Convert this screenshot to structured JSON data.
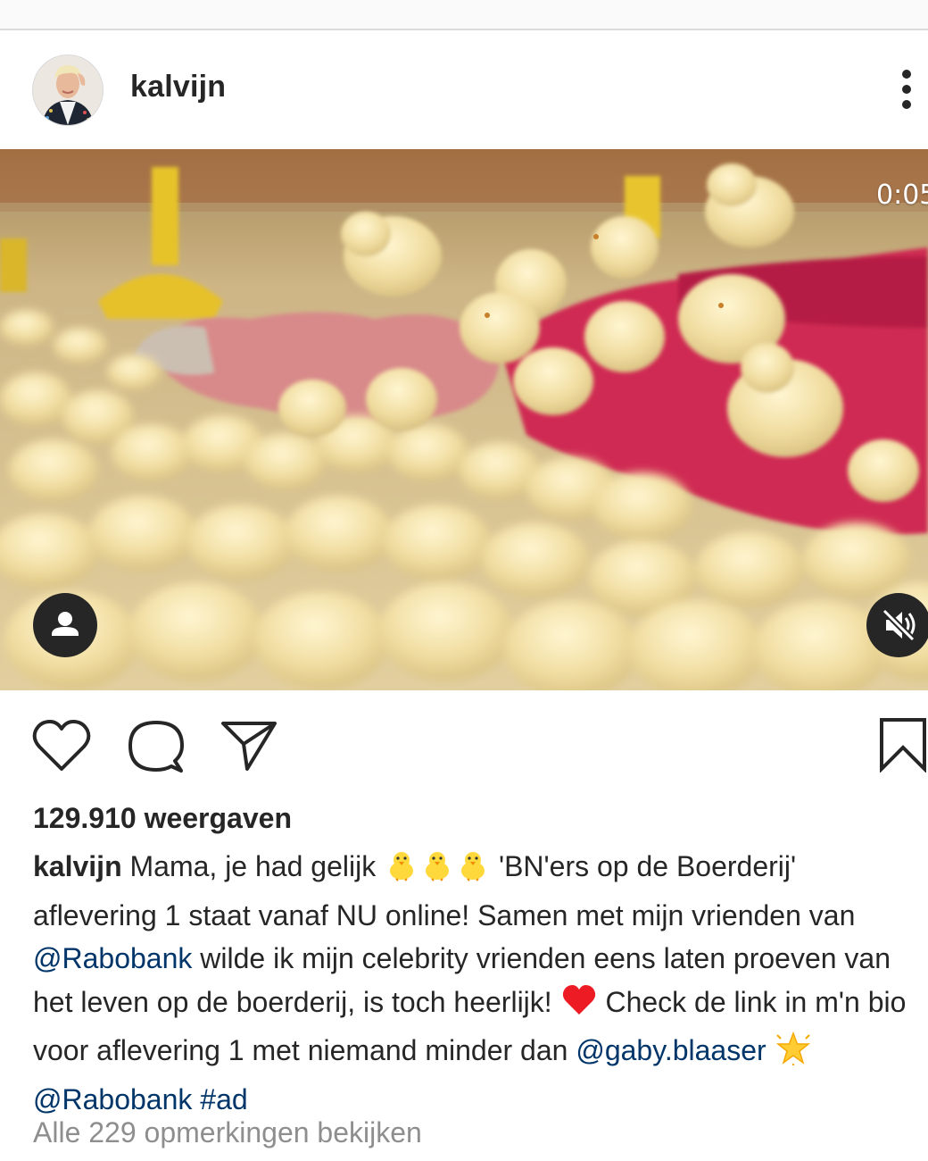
{
  "post": {
    "username": "kalvijn",
    "video_timer": "0:05",
    "views": "129.910 weergaven",
    "caption": {
      "username": "kalvijn",
      "text_1": "Mama, je had gelijk",
      "text_2": "'BN'ers op de Boerderij' aflevering 1 staat vanaf NU online! Samen met mijn vrienden van",
      "mention_1": "@Rabobank",
      "text_3": "wilde ik mijn celebrity vrienden eens laten proeven van het leven op de boerderij, is toch heerlijk!",
      "text_4": "Check de link in m'n bio voor aflevering 1 met niemand minder dan",
      "mention_2": "@gaby.blaaser",
      "mention_3": "@Rabobank",
      "hashtag": "#ad"
    },
    "view_comments": "Alle 229 opmerkingen bekijken"
  },
  "icons": {
    "more": "more-vertical-icon",
    "like": "heart-icon",
    "comment": "comment-icon",
    "share": "send-icon",
    "save": "bookmark-icon",
    "tags": "user-tag-icon",
    "mute": "speaker-muted-icon",
    "emoji_chick": "baby-chick-emoji",
    "emoji_heart": "red-heart-emoji",
    "emoji_star": "glowing-star-emoji"
  },
  "colors": {
    "text": "#262626",
    "link": "#003569",
    "muted": "#8e8e8e",
    "heart": "#ed1c24"
  }
}
